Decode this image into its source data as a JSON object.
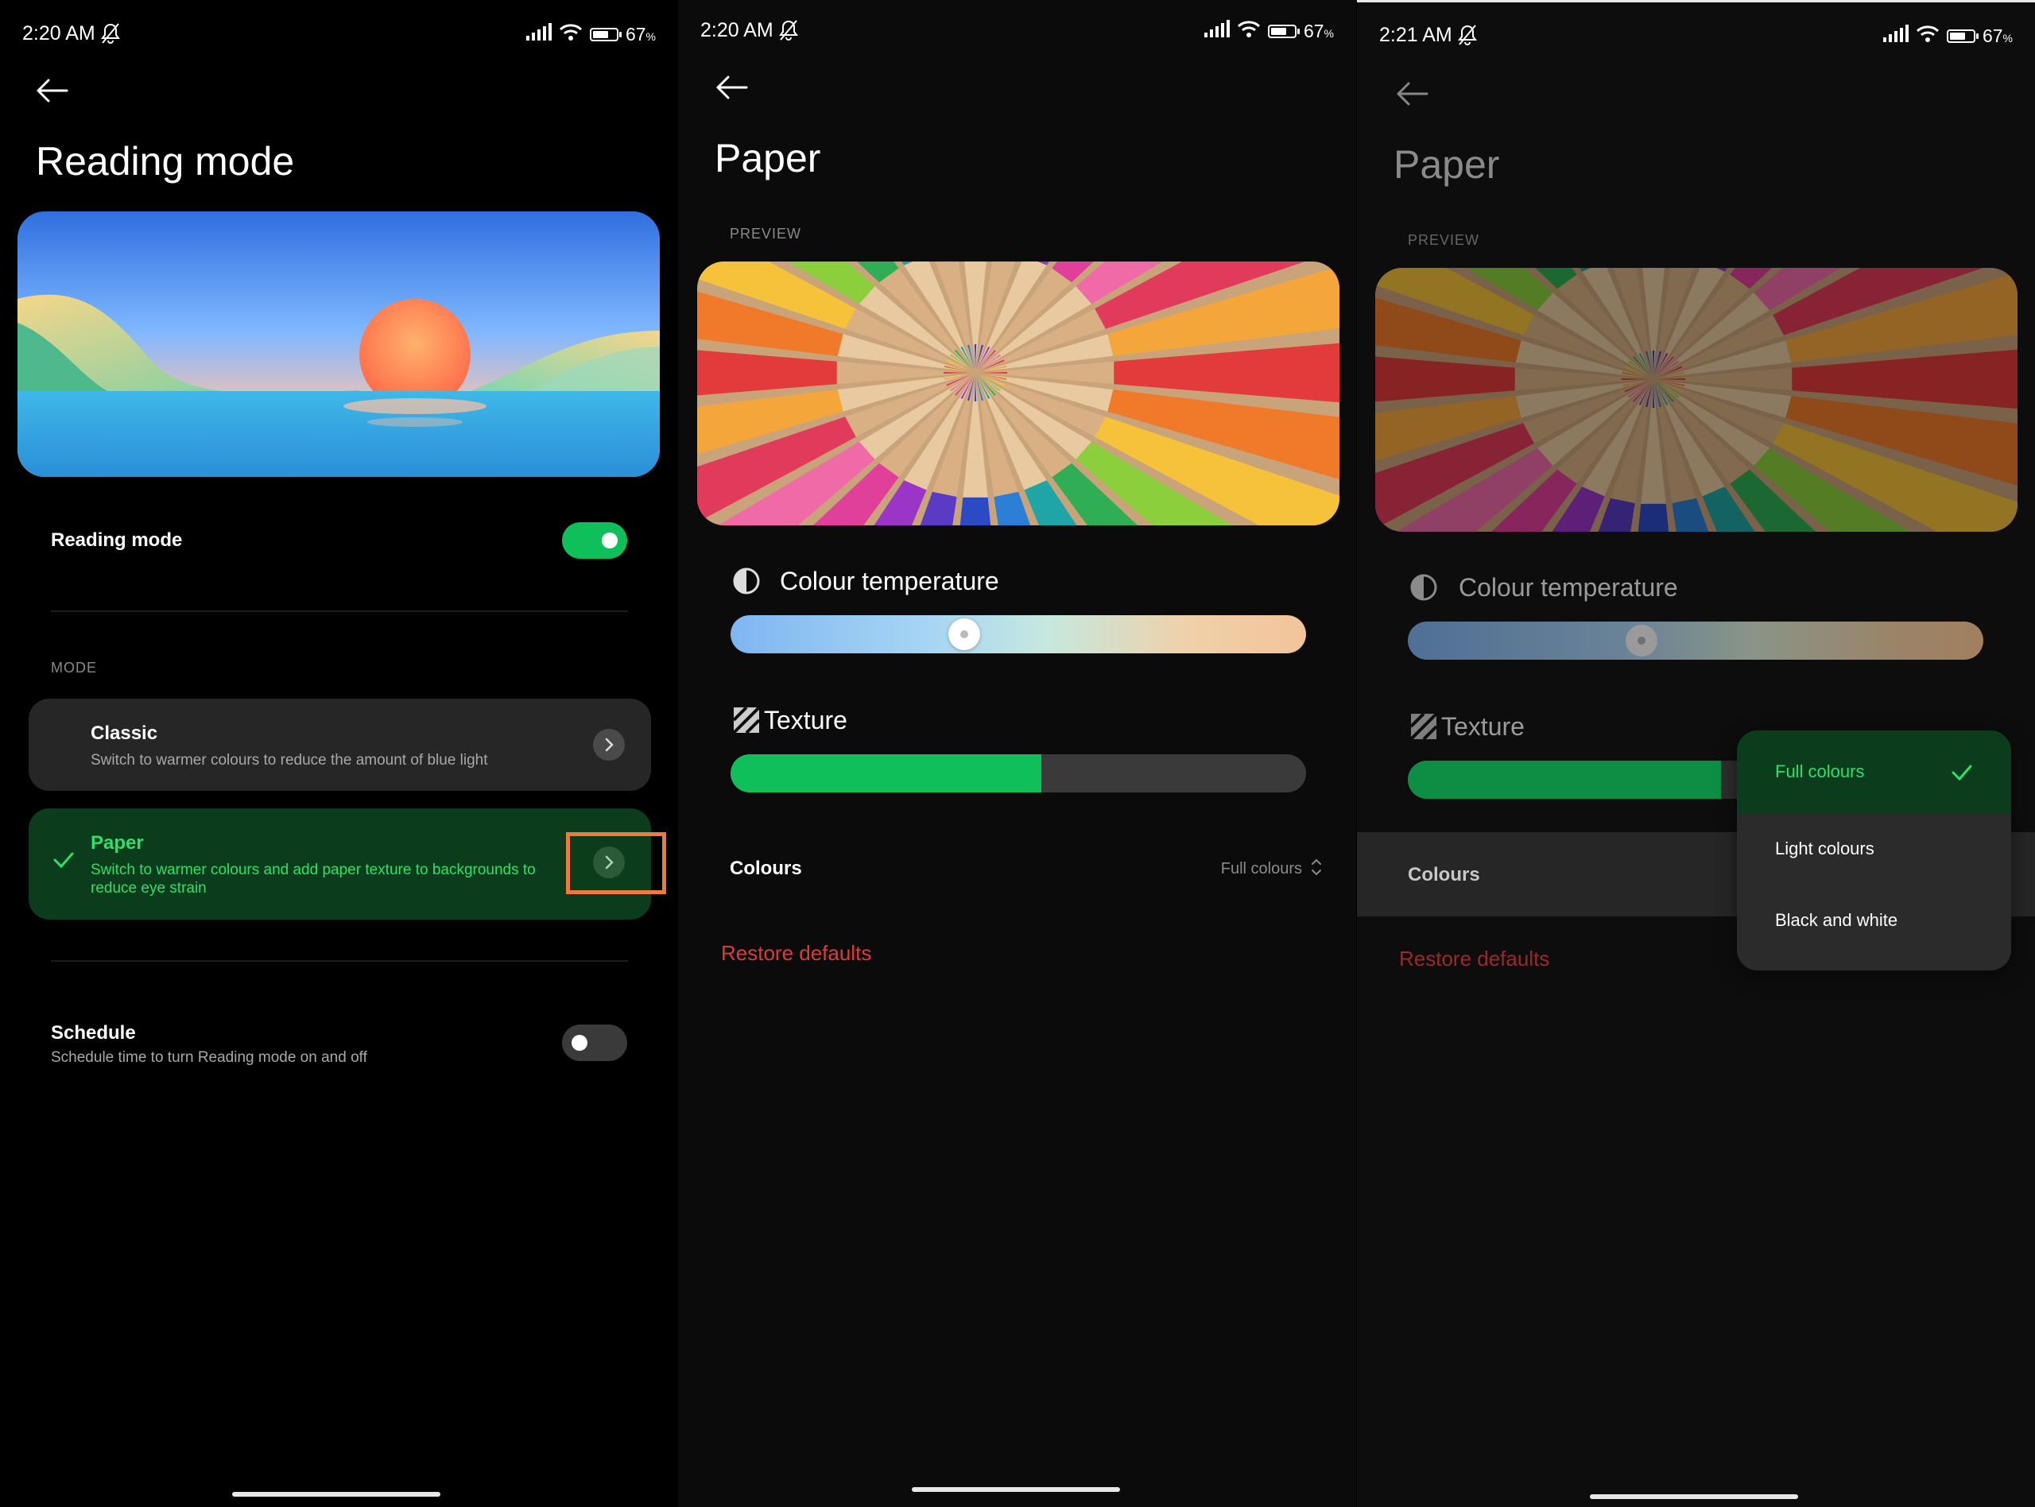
{
  "panel1": {
    "status": {
      "time": "2:20 AM",
      "battery": "67",
      "battery_unit": "%"
    },
    "title": "Reading mode",
    "reading_mode_label": "Reading mode",
    "reading_mode_on": true,
    "mode_section": "MODE",
    "modes": [
      {
        "title": "Classic",
        "subtitle": "Switch to warmer colours to reduce the amount of blue light",
        "selected": false
      },
      {
        "title": "Paper",
        "subtitle": "Switch to warmer colours and add paper texture to backgrounds to reduce eye strain",
        "selected": true
      }
    ],
    "schedule_label": "Schedule",
    "schedule_sub": "Schedule time to turn Reading mode on and off",
    "schedule_on": false
  },
  "panel2": {
    "status": {
      "time": "2:20 AM",
      "battery": "67",
      "battery_unit": "%"
    },
    "title": "Paper",
    "preview_label": "PREVIEW",
    "colour_temp_label": "Colour temperature",
    "colour_temp_value": 0.4,
    "texture_label": "Texture",
    "texture_value": 0.54,
    "colours_label": "Colours",
    "colours_value": "Full colours",
    "restore_label": "Restore defaults"
  },
  "panel3": {
    "status": {
      "time": "2:21 AM",
      "battery": "67",
      "battery_unit": "%"
    },
    "title": "Paper",
    "preview_label": "PREVIEW",
    "colour_temp_label": "Colour temperature",
    "colour_temp_value": 0.4,
    "texture_label": "Texture",
    "colours_label": "Colours",
    "restore_label": "Restore defaults",
    "menu_options": [
      "Full colours",
      "Light colours",
      "Black and white"
    ],
    "menu_selected": 0
  },
  "colors": {
    "accent_green": "#0fbf5a",
    "paper_card": "#0b3d1c",
    "paper_text": "#2ee06a",
    "restore_red": "#e03b3b",
    "highlight_box": "#f07a3c"
  }
}
